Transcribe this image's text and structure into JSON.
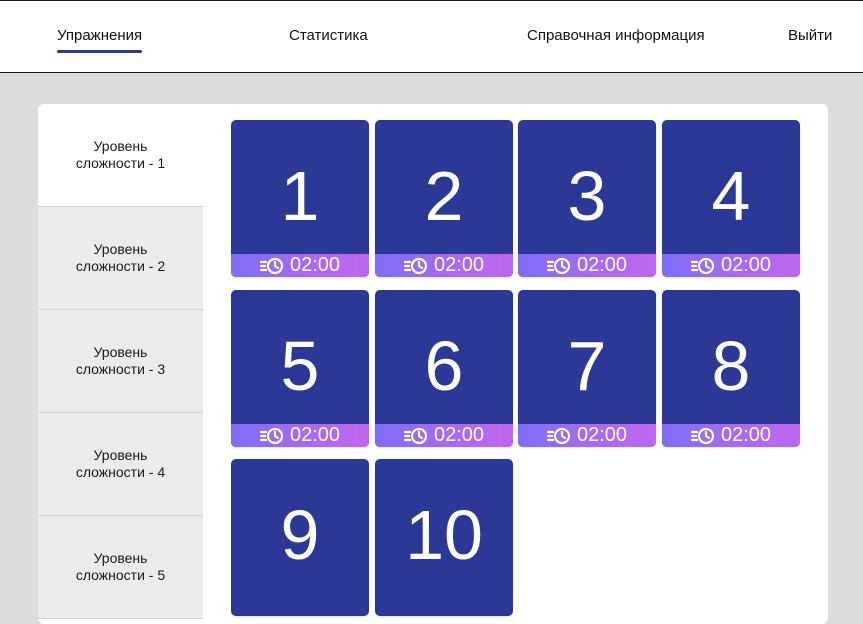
{
  "nav": [
    {
      "label": "Упражнения",
      "active": true
    },
    {
      "label": "Статистика",
      "active": false
    },
    {
      "label": "Справочная информация",
      "active": false
    },
    {
      "label": "Выйти",
      "active": false
    }
  ],
  "levels": [
    {
      "line1": "Уровень",
      "line2": "сложности - 1",
      "active": true
    },
    {
      "line1": "Уровень",
      "line2": "сложности - 2",
      "active": false
    },
    {
      "line1": "Уровень",
      "line2": "сложности - 3",
      "active": false
    },
    {
      "line1": "Уровень",
      "line2": "сложности - 4",
      "active": false
    },
    {
      "line1": "Уровень",
      "line2": "сложности - 5",
      "active": false
    }
  ],
  "exercises": [
    {
      "number": "1",
      "time": "02:00"
    },
    {
      "number": "2",
      "time": "02:00"
    },
    {
      "number": "3",
      "time": "02:00"
    },
    {
      "number": "4",
      "time": "02:00"
    },
    {
      "number": "5",
      "time": "02:00"
    },
    {
      "number": "6",
      "time": "02:00"
    },
    {
      "number": "7",
      "time": "02:00"
    },
    {
      "number": "8",
      "time": "02:00"
    },
    {
      "number": "9",
      "time": ""
    },
    {
      "number": "10",
      "time": ""
    }
  ],
  "icons": {
    "timer": "timer-icon"
  },
  "colors": {
    "tile": "#2b3896",
    "timer_start": "#7f6cf6",
    "timer_end": "#c066ef",
    "active_underline": "#2b3896"
  }
}
